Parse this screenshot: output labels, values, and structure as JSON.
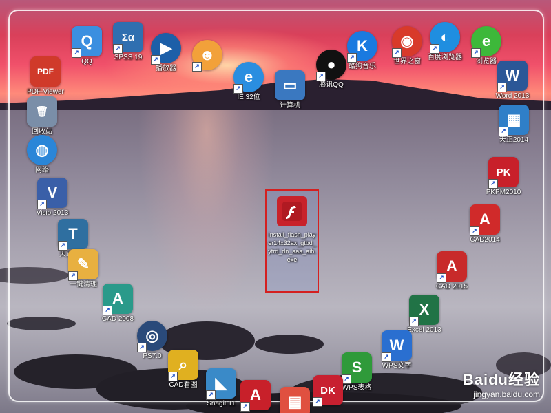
{
  "desktop": {
    "icons": [
      {
        "label": "QQ",
        "glyph": "Q",
        "color": "#3b8fe0",
        "shortcut": true
      },
      {
        "label": "SPSS 19",
        "glyph": "Σα",
        "color": "#2f6fb0",
        "shortcut": true
      },
      {
        "label": "播放器",
        "glyph": "▶",
        "color": "#1d5fa8",
        "shortcut": true,
        "round": true
      },
      {
        "label": "",
        "glyph": "☻",
        "color": "#f2a13a",
        "shortcut": true,
        "round": true
      },
      {
        "label": "IE 32位",
        "glyph": "e",
        "color": "#2a8ee0",
        "shortcut": true,
        "round": true
      },
      {
        "label": "计算机",
        "glyph": "▭",
        "color": "#3a78c0",
        "shortcut": false
      },
      {
        "label": "腾讯QQ",
        "glyph": "●",
        "color": "#111111",
        "shortcut": true,
        "round": true
      },
      {
        "label": "酷狗音乐",
        "glyph": "K",
        "color": "#1a7ae0",
        "shortcut": true,
        "round": true
      },
      {
        "label": "世界之窗",
        "glyph": "◉",
        "color": "#d83a2a",
        "shortcut": true,
        "round": true
      },
      {
        "label": "百度浏览器",
        "glyph": "◐",
        "color": "#1f8ee0",
        "shortcut": true,
        "round": true
      },
      {
        "label": "浏览器",
        "glyph": "e",
        "color": "#3db83a",
        "shortcut": true,
        "round": true
      },
      {
        "label": "PDF-Viewer",
        "glyph": "PDF",
        "color": "#d03a2a",
        "shortcut": false
      },
      {
        "label": "Word 2013",
        "glyph": "W",
        "color": "#2b5797",
        "shortcut": true
      },
      {
        "label": "回收站",
        "glyph": "🗑",
        "color": "#7a8ea8",
        "shortcut": false
      },
      {
        "label": "天正2014",
        "glyph": "▦",
        "color": "#2f7fc8",
        "shortcut": true
      },
      {
        "label": "网络",
        "glyph": "◍",
        "color": "#2a86d8",
        "shortcut": false,
        "round": true
      },
      {
        "label": "PKPM2010",
        "glyph": "PK",
        "color": "#c8202a",
        "shortcut": true
      },
      {
        "label": "Visio 2013",
        "glyph": "V",
        "color": "#3a5fa8",
        "shortcut": true
      },
      {
        "label": "CAD2014",
        "glyph": "A",
        "color": "#d02a2a",
        "shortcut": true
      },
      {
        "label": "天正建筑",
        "glyph": "T",
        "color": "#2f6fa0",
        "shortcut": true
      },
      {
        "label": "一键清理",
        "glyph": "✎",
        "color": "#e8b040",
        "shortcut": true
      },
      {
        "label": "CAD 2015",
        "glyph": "A",
        "color": "#c82a2a",
        "shortcut": true
      },
      {
        "label": "CAD 2008",
        "glyph": "A",
        "color": "#2a9a8a",
        "shortcut": true
      },
      {
        "label": "Excel 2013",
        "glyph": "X",
        "color": "#217346",
        "shortcut": true
      },
      {
        "label": "PS7.0",
        "glyph": "◎",
        "color": "#2a4a7a",
        "shortcut": true,
        "round": true
      },
      {
        "label": "WPS文字",
        "glyph": "W",
        "color": "#2a6fd0",
        "shortcut": true
      },
      {
        "label": "CAD看图",
        "glyph": "⌕",
        "color": "#e0b020",
        "shortcut": true
      },
      {
        "label": "WPS表格",
        "glyph": "S",
        "color": "#2f9a3a",
        "shortcut": true
      },
      {
        "label": "Snagit 11",
        "glyph": "◣",
        "color": "#3a8ac8",
        "shortcut": true
      },
      {
        "label": "",
        "glyph": "A",
        "color": "#c8202a",
        "shortcut": true
      },
      {
        "label": "",
        "glyph": "▤",
        "color": "#e05040",
        "shortcut": false
      },
      {
        "label": "",
        "glyph": "DK",
        "color": "#c82030",
        "shortcut": true
      }
    ],
    "selected_file": {
      "label": "install_flash_player14x32ax_gtbd_ytrd_dn_aaa_aih.exe",
      "glyph": "f",
      "color": "#c8222a"
    }
  },
  "watermark": {
    "brand": "Baidu经验",
    "url": "jingyan.baidu.com"
  }
}
